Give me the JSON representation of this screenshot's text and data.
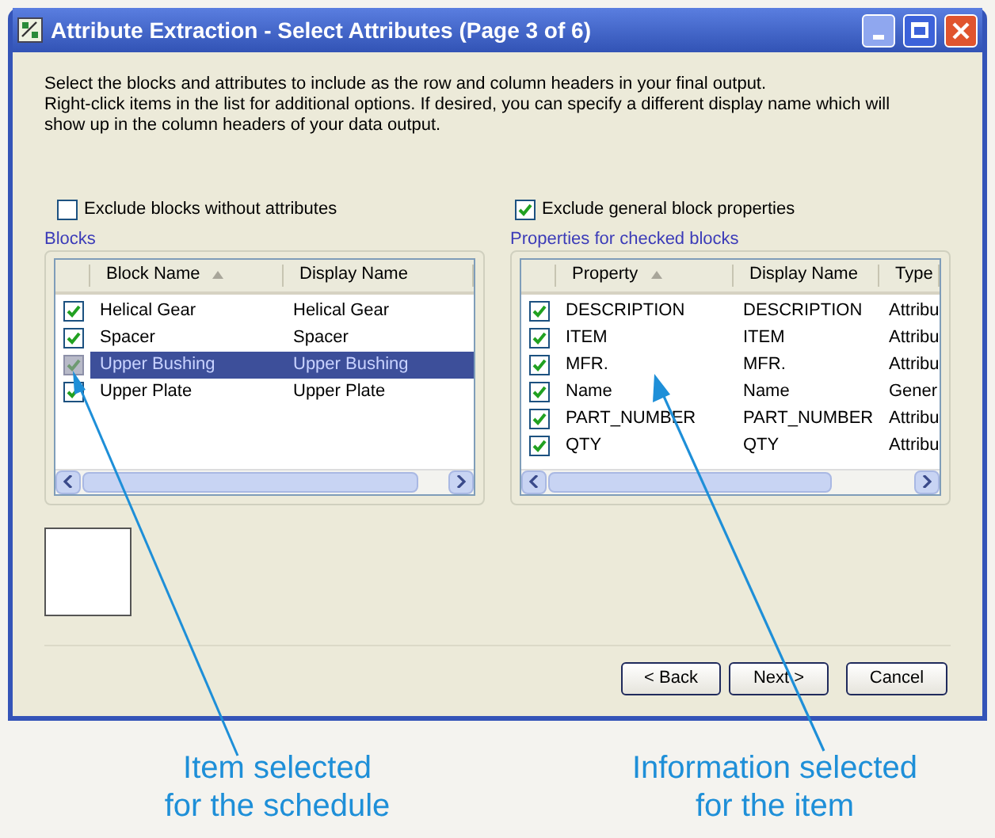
{
  "window": {
    "title": "Attribute Extraction - Select Attributes (Page 3 of 6)"
  },
  "instructions": [
    "Select the blocks and attributes to include as the row and column headers in your final output.",
    "Right-click items in the list for additional options. If desired, you can specify a different display name which will",
    "show up in the column headers of your data output."
  ],
  "exclude_blocks": {
    "label": "Exclude blocks without attributes",
    "checked": false
  },
  "exclude_general": {
    "label": "Exclude general block properties",
    "checked": true
  },
  "blocks": {
    "title": "Blocks",
    "columns": [
      {
        "label": "Block Name",
        "sorted": true
      },
      {
        "label": "Display Name",
        "sorted": false
      }
    ],
    "rows": [
      {
        "cells": [
          "Helical Gear",
          "Helical Gear"
        ],
        "checked": true,
        "selected": false
      },
      {
        "cells": [
          "Spacer",
          "Spacer"
        ],
        "checked": true,
        "selected": false
      },
      {
        "cells": [
          "Upper Bushing",
          "Upper Bushing"
        ],
        "checked": true,
        "selected": true
      },
      {
        "cells": [
          "Upper Plate",
          "Upper Plate"
        ],
        "checked": true,
        "selected": false
      }
    ]
  },
  "properties": {
    "title": "Properties for checked blocks",
    "columns": [
      {
        "label": "Property",
        "sorted": true
      },
      {
        "label": "Display Name",
        "sorted": false
      },
      {
        "label": "Type",
        "sorted": false
      }
    ],
    "rows": [
      {
        "cells": [
          "DESCRIPTION",
          "DESCRIPTION",
          "Attribu"
        ],
        "checked": true,
        "selected": false
      },
      {
        "cells": [
          "ITEM",
          "ITEM",
          "Attribu"
        ],
        "checked": true,
        "selected": false
      },
      {
        "cells": [
          "MFR.",
          "MFR.",
          "Attribu"
        ],
        "checked": true,
        "selected": false
      },
      {
        "cells": [
          "Name",
          "Name",
          "Gener"
        ],
        "checked": true,
        "selected": false
      },
      {
        "cells": [
          "PART_NUMBER",
          "PART_NUMBER",
          "Attribu"
        ],
        "checked": true,
        "selected": false
      },
      {
        "cells": [
          "QTY",
          "QTY",
          "Attribu"
        ],
        "checked": true,
        "selected": false
      }
    ]
  },
  "buttons": [
    "< Back",
    "Next >",
    "Cancel"
  ],
  "callouts": [
    {
      "lines": [
        "Item selected",
        "for the schedule"
      ]
    },
    {
      "lines": [
        "Information selected",
        "for the item"
      ]
    }
  ]
}
